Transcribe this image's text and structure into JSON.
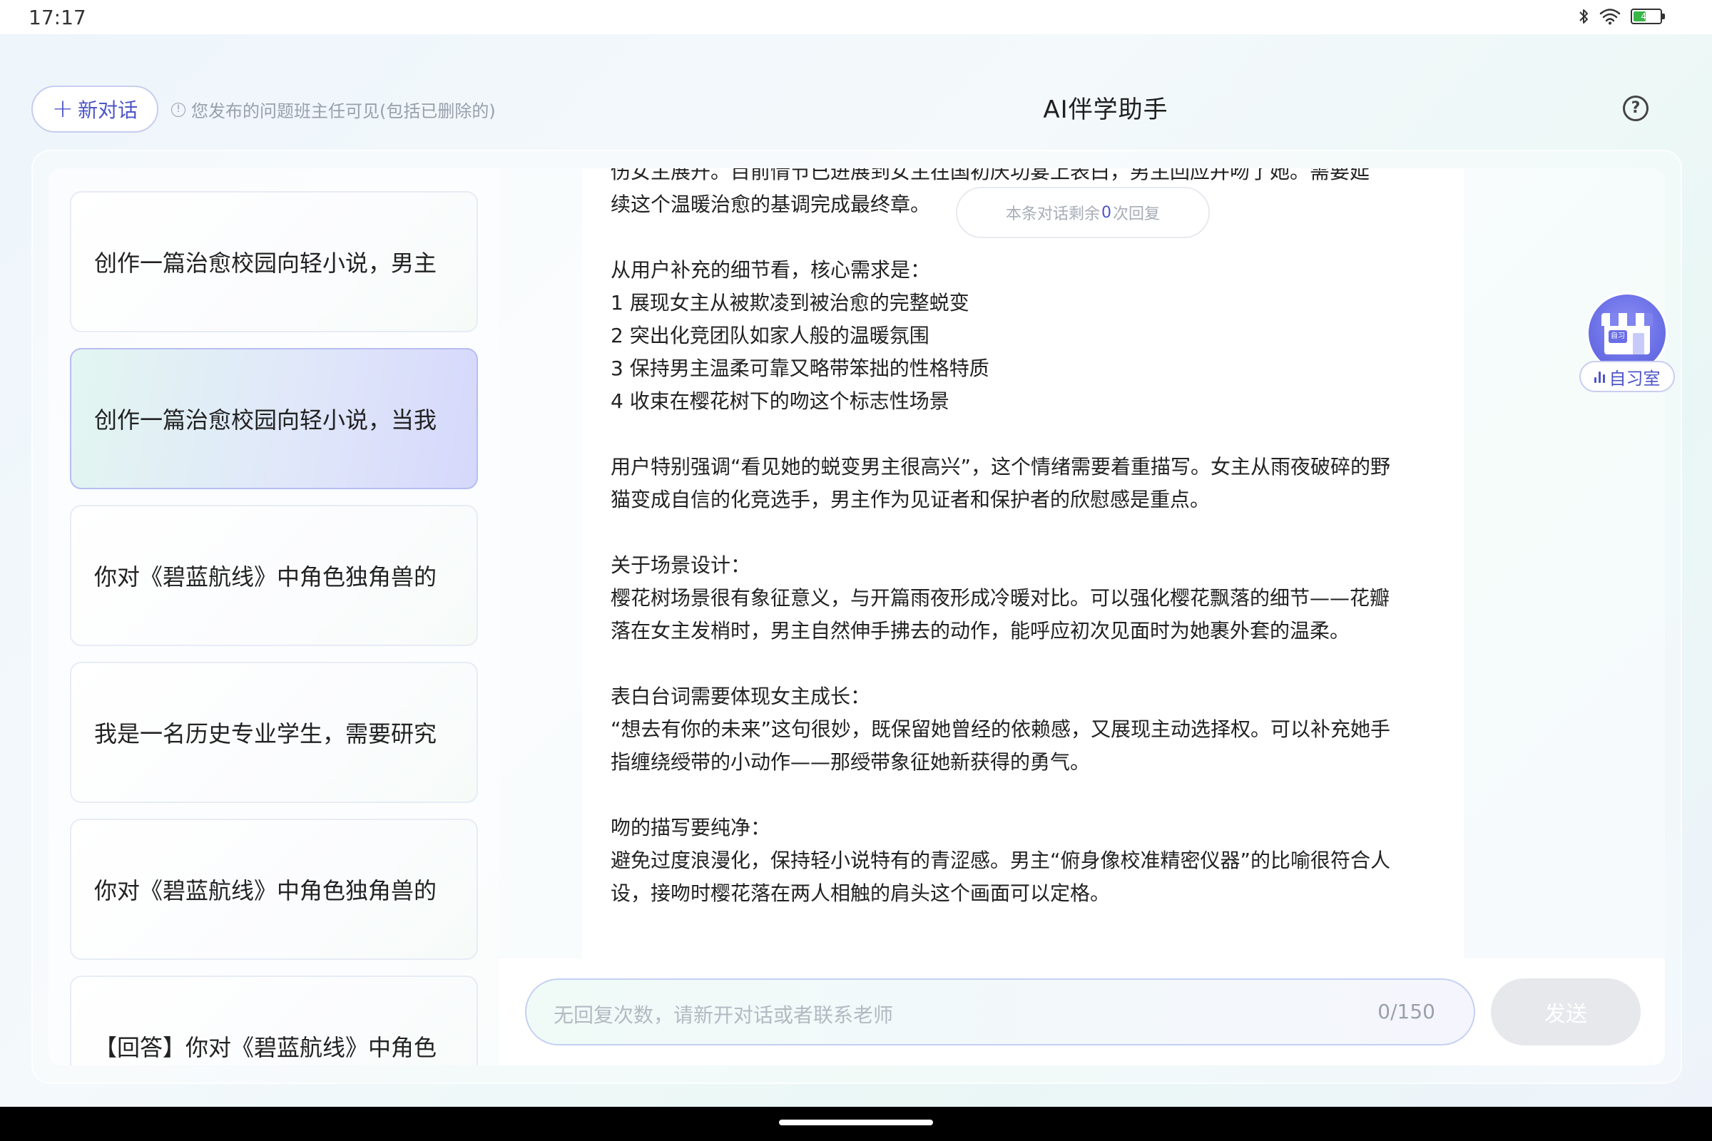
{
  "status_bar": {
    "time": "17:17",
    "battery_level": "46",
    "battery_fraction": 0.46
  },
  "header": {
    "new_chat_label": "新对话",
    "note": "您发布的问题班主任可见(包括已删除的)",
    "title": "AI伴学助手",
    "help_icon": "question-circle-icon"
  },
  "sidebar": {
    "items": [
      {
        "label": "创作一篇治愈校园向轻小说，男主"
      },
      {
        "label": "创作一篇治愈校园向轻小说，当我"
      },
      {
        "label": "你对《碧蓝航线》中角色独角兽的"
      },
      {
        "label": "我是一名历史专业学生，需要研究"
      },
      {
        "label": "你对《碧蓝航线》中角色独角兽的"
      },
      {
        "label": "【回答】你对《碧蓝航线》中角色"
      }
    ],
    "active_index": 1
  },
  "chat": {
    "remaining_prefix": "本条对话剩余",
    "remaining_count": "0",
    "remaining_suffix": "次回复",
    "lines": [
      "伤女主展开。目前情节已进展到女主在国初庆功宴上表白，男主回应并吻了她。需要延",
      "续这个温暖治愈的基调完成最终章。",
      "",
      "从用户补充的细节看，核心需求是：",
      "1 展现女主从被欺凌到被治愈的完整蜕变",
      "2 突出化竞团队如家人般的温暖氛围",
      "3 保持男主温柔可靠又略带笨拙的性格特质",
      "4 收束在樱花树下的吻这个标志性场景",
      "",
      "用户特别强调“看见她的蜕变男主很高兴”，这个情绪需要着重描写。女主从雨夜破碎的野",
      "猫变成自信的化竞选手，男主作为见证者和保护者的欣慰感是重点。",
      "",
      "关于场景设计：",
      "樱花树场景很有象征意义，与开篇雨夜形成冷暖对比。可以强化樱花飘落的细节——花瓣",
      "落在女主发梢时，男主自然伸手拂去的动作，能呼应初次见面时为她裹外套的温柔。",
      "",
      "表白台词需要体现女主成长：",
      "“想去有你的未来”这句很妙，既保留她曾经的依赖感，又展现主动选择权。可以补充她手",
      "指缠绕绶带的小动作——那绶带象征她新获得的勇气。",
      "",
      "吻的描写要纯净：",
      "避免过度浪漫化，保持轻小说特有的青涩感。男主“俯身像校准精密仪器”的比喻很符合人",
      "设，接吻时樱花落在两人相触的肩头这个画面可以定格。"
    ]
  },
  "input": {
    "placeholder": "无回复次数，请新开对话或者联系老师",
    "counter": "0/150",
    "send_label": "发送"
  },
  "study_room": {
    "label": "自习室",
    "sign": "自习"
  },
  "colors": {
    "accent": "#4d55c8",
    "active_item_border": "#b8bdf2",
    "send_disabled": "#e6e8ec",
    "muted_text": "#9aa0aa"
  }
}
